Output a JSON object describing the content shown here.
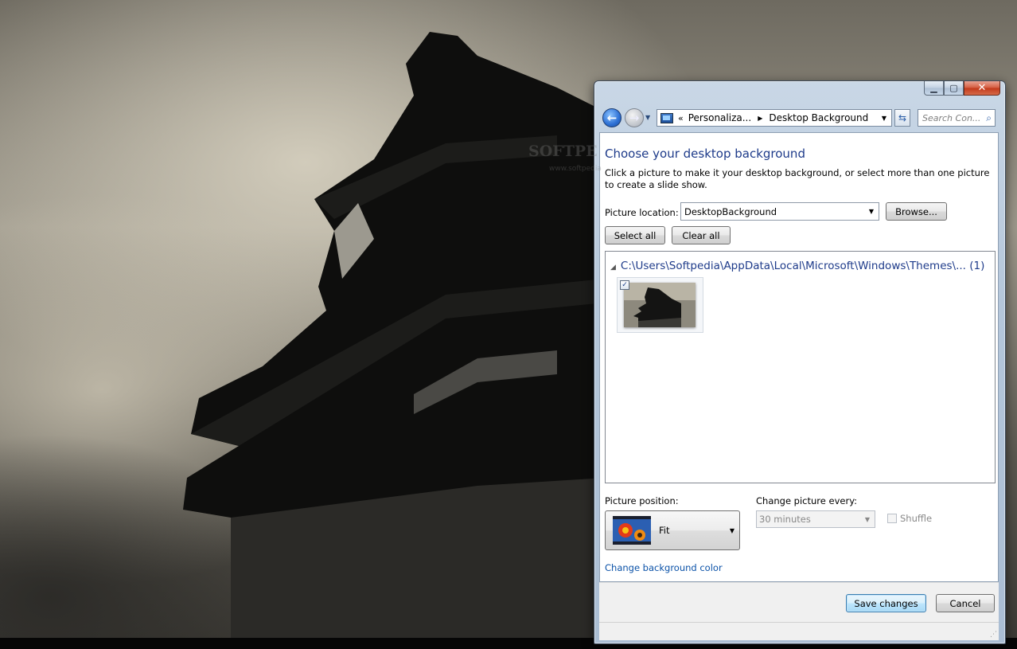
{
  "window": {
    "minimize_glyph": "▁",
    "maximize_glyph": "▢",
    "close_glyph": "✕"
  },
  "navigation": {
    "back_glyph": "←",
    "forward_glyph": "→",
    "recent_glyph": "▼",
    "breadcrumb_overflow": "«",
    "breadcrumb": [
      "Personaliza...",
      "Desktop Background"
    ],
    "breadcrumb_separator": "▶",
    "dropdown_glyph": "▼",
    "refresh_glyph": "⇆",
    "search_placeholder": "Search Con...",
    "search_glyph": "⌕"
  },
  "watermark": {
    "text": "SOFTPE",
    "sub": "www.softpedia"
  },
  "main": {
    "title": "Choose your desktop background",
    "description": "Click a picture to make it your desktop background, or select more than one picture to create a slide show.",
    "picture_location_label": "Picture location:",
    "picture_location_value": "DesktopBackground",
    "browse_label": "Browse...",
    "select_all_label": "Select all",
    "clear_all_label": "Clear all",
    "group": {
      "expand_glyph": "◢",
      "path": "C:\\Users\\Softpedia\\AppData\\Local\\Microsoft\\Windows\\Themes\\... (1)"
    },
    "thumbnail_checked_glyph": "✓",
    "picture_position_label": "Picture position:",
    "picture_position_value": "Fit",
    "change_picture_label": "Change picture every:",
    "change_picture_value": "30 minutes",
    "shuffle_label": "Shuffle",
    "change_bg_color_link": "Change background color"
  },
  "footer": {
    "save_label": "Save changes",
    "cancel_label": "Cancel",
    "grip_glyph": "⋰"
  },
  "colors": {
    "title_blue": "#1e3b8a",
    "link_blue": "#0b52a8",
    "close_red": "#c2381a",
    "chrome_blue": "#b4c6da"
  }
}
